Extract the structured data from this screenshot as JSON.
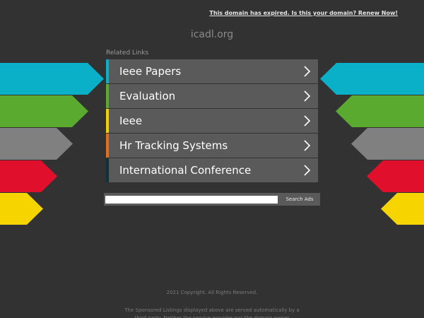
{
  "banner": {
    "expired_text": "This domain has expired. Is this your domain? Renew Now!"
  },
  "header": {
    "domain": "icadl.org"
  },
  "related": {
    "label": "Related Links",
    "links": [
      {
        "label": "Ieee Papers",
        "accent": "#0ab0c8"
      },
      {
        "label": "Evaluation",
        "accent": "#5aaa30"
      },
      {
        "label": "Ieee",
        "accent": "#f0d000"
      },
      {
        "label": "Hr Tracking Systems",
        "accent": "#e07020"
      },
      {
        "label": "International Conference",
        "accent": "#103040"
      }
    ]
  },
  "decor": {
    "arrow_colors": [
      "#0ab0c8",
      "#5aaa30",
      "#808080",
      "#e0102c",
      "#f5d400"
    ]
  },
  "search": {
    "value": "",
    "button_label": "Search Ads"
  },
  "footer": {
    "copyright": "2021 Copyright. All Rights Reserved.",
    "disclaimer": "The Sponsored Listings displayed above are served automatically by a third party. Neither the service provider nor the domain owner"
  }
}
